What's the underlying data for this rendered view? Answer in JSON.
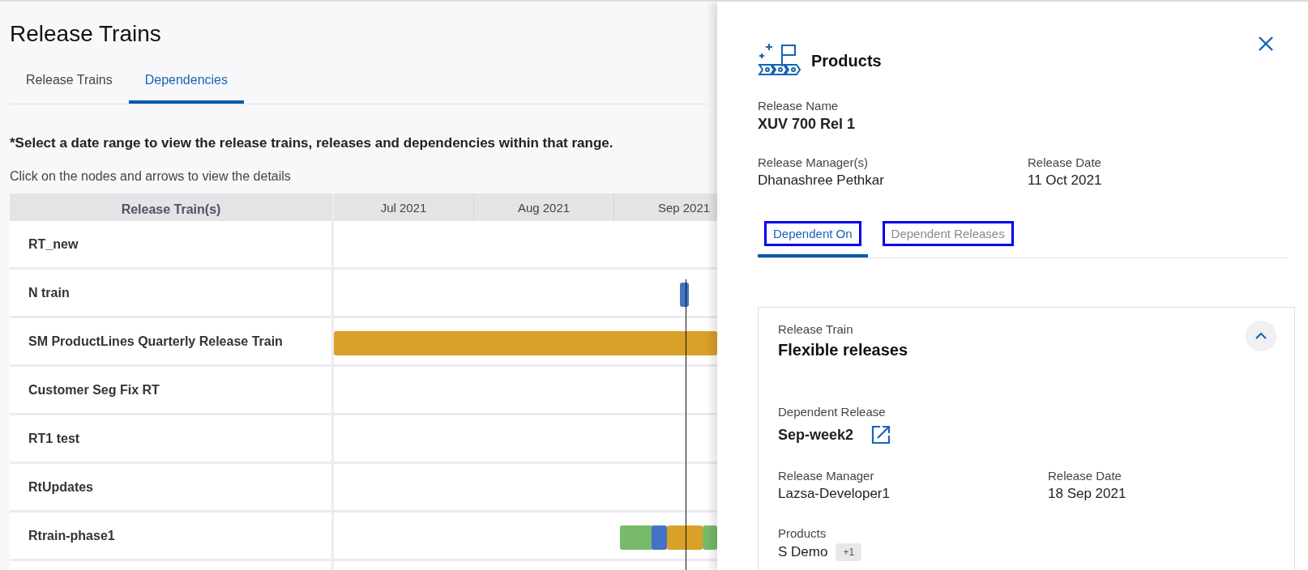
{
  "page_title": "Release Trains",
  "tabs": [
    {
      "label": "Release Trains",
      "selected": false
    },
    {
      "label": "Dependencies",
      "selected": true
    }
  ],
  "instruction": "*Select a date range to view the release trains, releases and dependencies within that range.",
  "hint": "Click on the nodes and arrows to view the details",
  "timeline": {
    "header": "Release Train(s)",
    "months": [
      "Jul 2021",
      "Aug 2021",
      "Sep 2021"
    ],
    "rows": [
      {
        "name": "RT_new",
        "bars": []
      },
      {
        "name": "N train",
        "bars": [
          {
            "color": "#4472c4"
          }
        ]
      },
      {
        "name": "SM ProductLines Quarterly Release Train",
        "bars": [
          {
            "color": "#d9a02a"
          }
        ]
      },
      {
        "name": "Customer Seg Fix RT",
        "bars": []
      },
      {
        "name": "RT1 test",
        "bars": []
      },
      {
        "name": "RtUpdates",
        "bars": []
      },
      {
        "name": "Rtrain-phase1",
        "bars": [
          {
            "color": "#77bb6a"
          },
          {
            "color": "#4472c4"
          },
          {
            "color": "#d9a02a"
          },
          {
            "color": "#77bb6a"
          }
        ]
      }
    ]
  },
  "panel": {
    "title": "Products",
    "release_name_label": "Release Name",
    "release_name": "XUV 700 Rel 1",
    "fields": [
      {
        "label": "Release Manager(s)",
        "value": "Dhanashree Pethkar"
      },
      {
        "label": "Release Date",
        "value": "11 Oct 2021"
      }
    ],
    "tabs": [
      {
        "label": "Dependent On",
        "selected": true,
        "highlighted": true
      },
      {
        "label": "Dependent Releases",
        "selected": false,
        "highlighted": true
      }
    ],
    "card": {
      "label": "Release Train",
      "title": "Flexible releases",
      "expanded": true,
      "dependent_label": "Dependent Release",
      "dependent_value": "Sep-week2",
      "fields": [
        {
          "label": "Release Manager",
          "value": "Lazsa-Developer1"
        },
        {
          "label": "Release Date",
          "value": "18 Sep 2021"
        }
      ],
      "products_label": "Products",
      "products_value": "S Demo",
      "more_badge": "+1"
    }
  }
}
